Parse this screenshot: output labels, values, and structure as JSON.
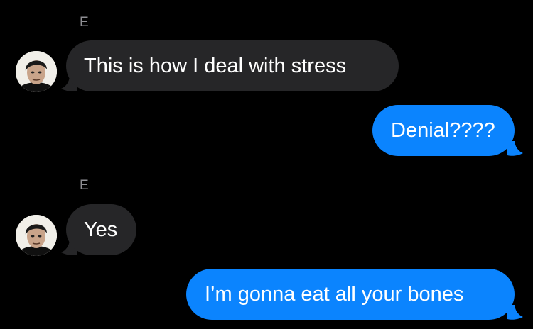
{
  "conversation": {
    "colors": {
      "background": "#000000",
      "incoming_bubble": "#262628",
      "outgoing_bubble": "#0b84fe",
      "sender_name": "#8e8e93",
      "text": "#ffffff"
    },
    "messages": [
      {
        "sender": "E",
        "direction": "incoming",
        "text": "This is how I deal with stress"
      },
      {
        "direction": "outgoing",
        "text": "Denial????"
      },
      {
        "sender": "E",
        "direction": "incoming",
        "text": "Yes"
      },
      {
        "direction": "outgoing",
        "text": "I’m gonna eat all your bones"
      }
    ]
  }
}
